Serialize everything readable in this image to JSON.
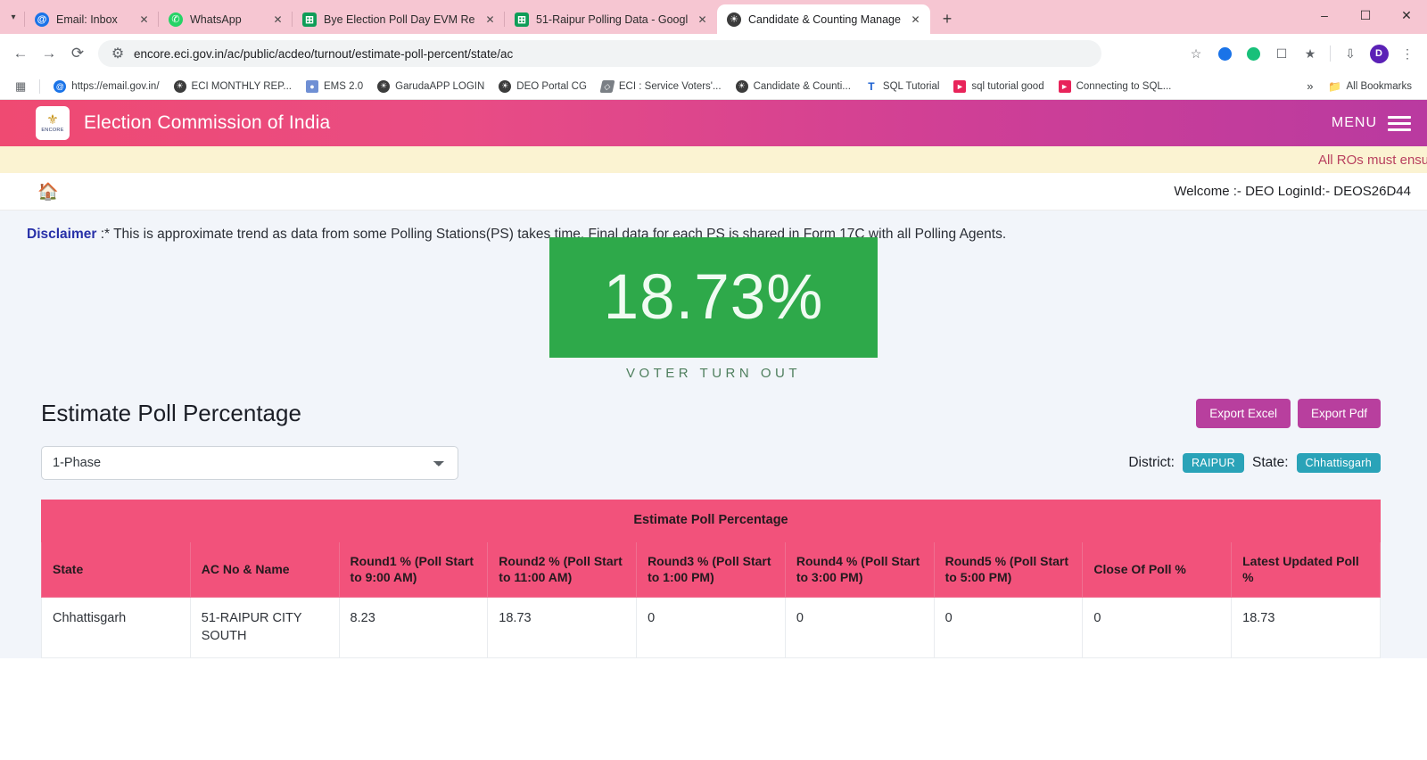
{
  "browser": {
    "tabs": [
      {
        "title": "Email: Inbox",
        "icon": "email-favicon",
        "active": false
      },
      {
        "title": "WhatsApp",
        "icon": "whatsapp-favicon",
        "active": false
      },
      {
        "title": "Bye Election Poll Day EVM Rep",
        "icon": "google-sheets-favicon",
        "active": false
      },
      {
        "title": "51-Raipur Polling Data - Googl",
        "icon": "google-sheets-favicon",
        "active": false
      },
      {
        "title": "Candidate & Counting Manage",
        "icon": "globe-favicon",
        "active": true
      }
    ],
    "new_tab_label": "+",
    "window_controls": {
      "minimize": "–",
      "maximize": "❐",
      "close": "✕"
    },
    "url": "encore.eci.gov.in/ac/public/acdeo/turnout/estimate-poll-percent/state/ac",
    "profile_initial": "D",
    "bookmarks": [
      {
        "label": "https://email.gov.in/",
        "icon": "email-favicon"
      },
      {
        "label": "ECI MONTHLY REP...",
        "icon": "globe-favicon"
      },
      {
        "label": "EMS 2.0",
        "icon": "ems-favicon"
      },
      {
        "label": "GarudaAPP LOGIN",
        "icon": "globe-favicon"
      },
      {
        "label": "DEO Portal CG",
        "icon": "globe-favicon"
      },
      {
        "label": "ECI : Service Voters'...",
        "icon": "eci-favicon"
      },
      {
        "label": "Candidate & Counti...",
        "icon": "globe-favicon"
      },
      {
        "label": "SQL Tutorial",
        "icon": "text-t-favicon"
      },
      {
        "label": "sql tutorial good",
        "icon": "youtube-favicon"
      },
      {
        "label": "Connecting to SQL...",
        "icon": "youtube-favicon"
      }
    ],
    "overflow_label": "»",
    "all_bookmarks_label": "All Bookmarks"
  },
  "site": {
    "header_title": "Election Commission of India",
    "logo_text": "ENCORE",
    "menu_label": "MENU",
    "marquee": "All ROs must ensure a",
    "welcome": "Welcome :- DEO LoginId:- DEOS26D44"
  },
  "main": {
    "disclaimer_label": "Disclaimer",
    "disclaimer_text": " :* This is approximate trend as data from some Polling Stations(PS) takes time. Final data for each PS is shared in Form 17C with all Polling Agents.",
    "turnout_value": "18.73%",
    "turnout_label": "VOTER TURN OUT",
    "page_title": "Estimate Poll Percentage",
    "export_excel_label": "Export Excel",
    "export_pdf_label": "Export Pdf",
    "phase_selected": "1-Phase",
    "district_label": "District:",
    "district_value": "RAIPUR",
    "state_label": "State:",
    "state_value": "Chhattisgarh"
  },
  "table": {
    "caption": "Estimate Poll Percentage",
    "headers": [
      "State",
      "AC No & Name",
      "Round1 %\n(Poll Start to 9:00 AM)",
      "Round2 %\n(Poll Start to 11:00 AM)",
      "Round3 %\n(Poll Start to 1:00 PM)",
      "Round4 %\n(Poll Start to 3:00 PM)",
      "Round5 %\n(Poll Start to 5:00 PM)",
      "Close Of Poll %",
      "Latest Updated Poll %"
    ],
    "rows": [
      {
        "state": "Chhattisgarh",
        "ac": "51-RAIPUR CITY SOUTH",
        "round1": "8.23",
        "round2": "18.73",
        "round3": "0",
        "round4": "0",
        "round5": "0",
        "close_of_poll": "0",
        "latest": "18.73"
      }
    ]
  },
  "colors": {
    "header_gradient_start": "#ef4a72",
    "header_gradient_end": "#b93aa0",
    "turnout_green": "#2ea94a",
    "table_pink": "#f2527b",
    "badge_teal": "#2aa3b8",
    "export_magenta": "#b83f9e",
    "marquee_bg": "#fbf3d2"
  }
}
